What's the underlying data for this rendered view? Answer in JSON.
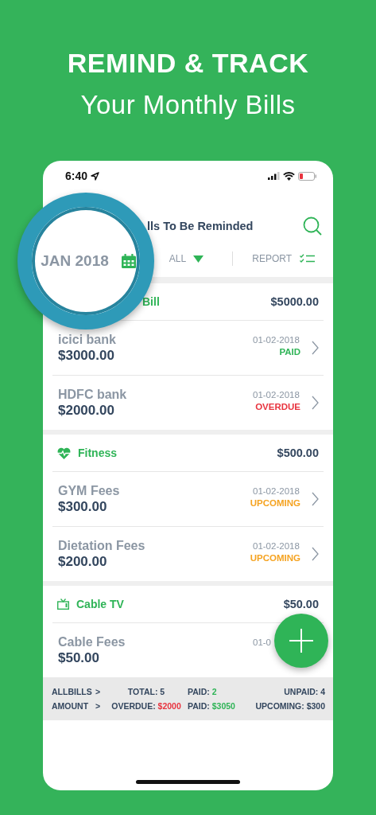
{
  "headline": {
    "line1": "REMIND & TRACK",
    "line2": "Your Monthly Bills"
  },
  "status_bar": {
    "time": "6:40"
  },
  "header": {
    "title": "lls To Be Reminded"
  },
  "filters": {
    "month": "JAN 2018",
    "category": "ALL",
    "report": "REPORT"
  },
  "groups": [
    {
      "kind": "covered",
      "name": "Bill",
      "total": "$5000.00",
      "bills": [
        {
          "name": "icici bank",
          "amount": "$3000.00",
          "date": "01-02-2018",
          "status_label": "PAID",
          "color": "#2fb457"
        },
        {
          "name": "HDFC bank",
          "amount": "$2000.00",
          "date": "01-02-2018",
          "status_label": "OVERDUE",
          "color": "#e8343f"
        }
      ]
    },
    {
      "kind": "fitness",
      "name": "Fitness",
      "total": "$500.00",
      "bills": [
        {
          "name": "GYM Fees",
          "amount": "$300.00",
          "date": "01-02-2018",
          "status_label": "UPCOMING",
          "color": "#f5a321"
        },
        {
          "name": "Dietation Fees",
          "amount": "$200.00",
          "date": "01-02-2018",
          "status_label": "UPCOMING",
          "color": "#f5a321"
        }
      ]
    },
    {
      "kind": "tv",
      "name": "Cable TV",
      "total": "$50.00",
      "bills": [
        {
          "name": "Cable Fees",
          "amount": "$50.00",
          "date": "01-0"
        }
      ]
    }
  ],
  "summary": [
    {
      "label": "ALLBILLS",
      "arrow": ">",
      "cells": [
        {
          "label": "TOTAL:",
          "value": "5",
          "color": "#33465e"
        },
        {
          "label": "PAID:",
          "value": "2",
          "color": "#2fb457"
        },
        {
          "label": "UNPAID:",
          "value": "4",
          "color": "#33465e"
        }
      ]
    },
    {
      "label": "AMOUNT",
      "arrow": ">",
      "cells": [
        {
          "label": "OVERDUE:",
          "value": "$2000",
          "color": "#e8343f"
        },
        {
          "label": "PAID:",
          "value": "$3050",
          "color": "#2fb457"
        },
        {
          "label": "UPCOMING:",
          "value": "$300",
          "color": "#33465e"
        }
      ]
    }
  ]
}
